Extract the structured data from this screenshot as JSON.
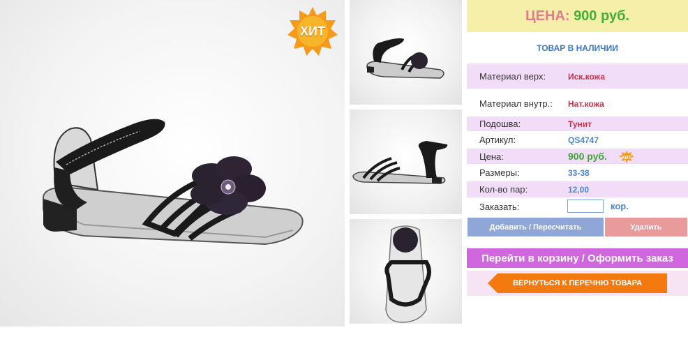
{
  "badge": {
    "hit_text": "ХИТ"
  },
  "price_header": {
    "label": "ЦЕНА:",
    "value": "900 руб."
  },
  "stock_status": "ТОВАР В НАЛИЧИИ",
  "specs": [
    {
      "label": "Материал верх:",
      "value": "Иск.кожа"
    },
    {
      "label": "Материал внутр.:",
      "value": "Нат.кожа"
    },
    {
      "label": "Подошва:",
      "value": "Тунит"
    },
    {
      "label": "Артикул:",
      "value": "QS4747"
    },
    {
      "label": "Цена:",
      "value": "900 руб."
    },
    {
      "label": "Размеры:",
      "value": "33-38"
    },
    {
      "label": "Кол-во пар:",
      "value": "12,00"
    }
  ],
  "order": {
    "label": "Заказать:",
    "value": "",
    "unit": "кор."
  },
  "buttons": {
    "add": "Добавить / Пересчитать",
    "delete": "Удалить",
    "cart": "Перейти в корзину / Оформить заказ",
    "back": "ВЕРНУТЬСЯ К ПЕРЕЧНЮ ТОВАРА"
  },
  "colors": {
    "price_bg": "#f6efaa",
    "accent_green": "#44b03a",
    "accent_blue": "#4c86cf",
    "cart_purple": "#d067df",
    "back_orange": "#f47a10"
  }
}
